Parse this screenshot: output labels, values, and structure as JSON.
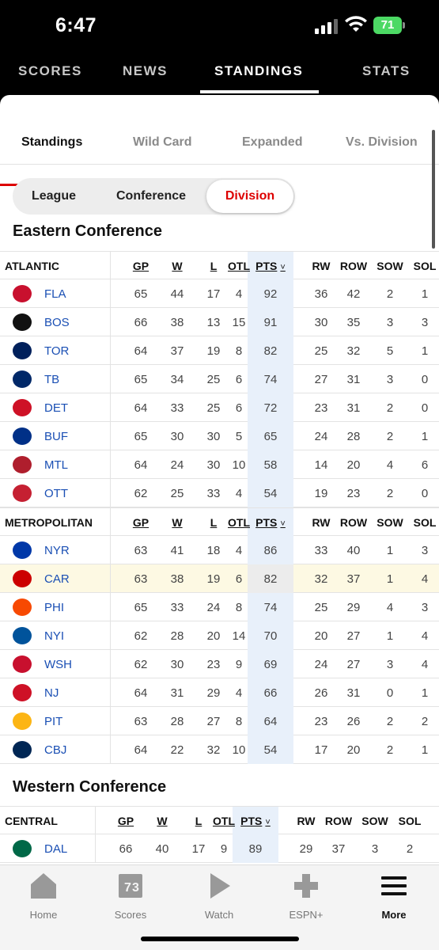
{
  "status_bar": {
    "time": "6:47",
    "battery": "71"
  },
  "top_nav": {
    "tabs": [
      "SCORES",
      "NEWS",
      "STANDINGS",
      "STATS"
    ],
    "active": "STANDINGS"
  },
  "sub_tabs": [
    "Standings",
    "Wild Card",
    "Expanded",
    "Vs. Division"
  ],
  "segment": {
    "options": [
      "League",
      "Conference",
      "Division"
    ],
    "active": "Division"
  },
  "columns": [
    "GP",
    "W",
    "L",
    "OTL",
    "PTS",
    "RW",
    "ROW",
    "SOW",
    "SOL"
  ],
  "sort_icon": "chevron-down-icon",
  "conferences": {
    "eastern": {
      "title": "Eastern Conference",
      "divisions": [
        {
          "name": "ATLANTIC",
          "teams": [
            {
              "abbr": "FLA",
              "color": "#c8102e",
              "stats": [
                "65",
                "44",
                "17",
                "4",
                "92",
                "36",
                "42",
                "2",
                "1"
              ]
            },
            {
              "abbr": "BOS",
              "color": "#111111",
              "stats": [
                "66",
                "38",
                "13",
                "15",
                "91",
                "30",
                "35",
                "3",
                "3"
              ]
            },
            {
              "abbr": "TOR",
              "color": "#00205b",
              "stats": [
                "64",
                "37",
                "19",
                "8",
                "82",
                "25",
                "32",
                "5",
                "1"
              ]
            },
            {
              "abbr": "TB",
              "color": "#002868",
              "stats": [
                "65",
                "34",
                "25",
                "6",
                "74",
                "27",
                "31",
                "3",
                "0"
              ]
            },
            {
              "abbr": "DET",
              "color": "#ce1126",
              "stats": [
                "64",
                "33",
                "25",
                "6",
                "72",
                "23",
                "31",
                "2",
                "0"
              ]
            },
            {
              "abbr": "BUF",
              "color": "#003087",
              "stats": [
                "65",
                "30",
                "30",
                "5",
                "65",
                "24",
                "28",
                "2",
                "1"
              ]
            },
            {
              "abbr": "MTL",
              "color": "#af1e2d",
              "stats": [
                "64",
                "24",
                "30",
                "10",
                "58",
                "14",
                "20",
                "4",
                "6"
              ]
            },
            {
              "abbr": "OTT",
              "color": "#c52032",
              "stats": [
                "62",
                "25",
                "33",
                "4",
                "54",
                "19",
                "23",
                "2",
                "0"
              ]
            }
          ]
        },
        {
          "name": "METROPOLITAN",
          "teams": [
            {
              "abbr": "NYR",
              "color": "#0038a8",
              "stats": [
                "63",
                "41",
                "18",
                "4",
                "86",
                "33",
                "40",
                "1",
                "3"
              ]
            },
            {
              "abbr": "CAR",
              "color": "#cc0000",
              "stats": [
                "63",
                "38",
                "19",
                "6",
                "82",
                "32",
                "37",
                "1",
                "4"
              ],
              "highlight": true
            },
            {
              "abbr": "PHI",
              "color": "#f74902",
              "stats": [
                "65",
                "33",
                "24",
                "8",
                "74",
                "25",
                "29",
                "4",
                "3"
              ]
            },
            {
              "abbr": "NYI",
              "color": "#00539b",
              "stats": [
                "62",
                "28",
                "20",
                "14",
                "70",
                "20",
                "27",
                "1",
                "4"
              ]
            },
            {
              "abbr": "WSH",
              "color": "#c8102e",
              "stats": [
                "62",
                "30",
                "23",
                "9",
                "69",
                "24",
                "27",
                "3",
                "4"
              ]
            },
            {
              "abbr": "NJ",
              "color": "#ce1126",
              "stats": [
                "64",
                "31",
                "29",
                "4",
                "66",
                "26",
                "31",
                "0",
                "1"
              ]
            },
            {
              "abbr": "PIT",
              "color": "#fcb514",
              "stats": [
                "63",
                "28",
                "27",
                "8",
                "64",
                "23",
                "26",
                "2",
                "2"
              ]
            },
            {
              "abbr": "CBJ",
              "color": "#002654",
              "stats": [
                "64",
                "22",
                "32",
                "10",
                "54",
                "17",
                "20",
                "2",
                "1"
              ]
            }
          ]
        }
      ]
    },
    "western": {
      "title": "Western Conference",
      "divisions": [
        {
          "name": "CENTRAL",
          "teams": [
            {
              "abbr": "DAL",
              "color": "#006847",
              "stats": [
                "66",
                "40",
                "17",
                "9",
                "89",
                "29",
                "37",
                "3",
                "2"
              ]
            }
          ]
        }
      ]
    }
  },
  "bottom_nav": [
    {
      "label": "Home",
      "icon": "home-icon"
    },
    {
      "label": "Scores",
      "icon": "scoreboard-icon"
    },
    {
      "label": "Watch",
      "icon": "play-icon"
    },
    {
      "label": "ESPN+",
      "icon": "espn-plus-icon"
    },
    {
      "label": "More",
      "icon": "menu-icon",
      "active": true
    }
  ]
}
